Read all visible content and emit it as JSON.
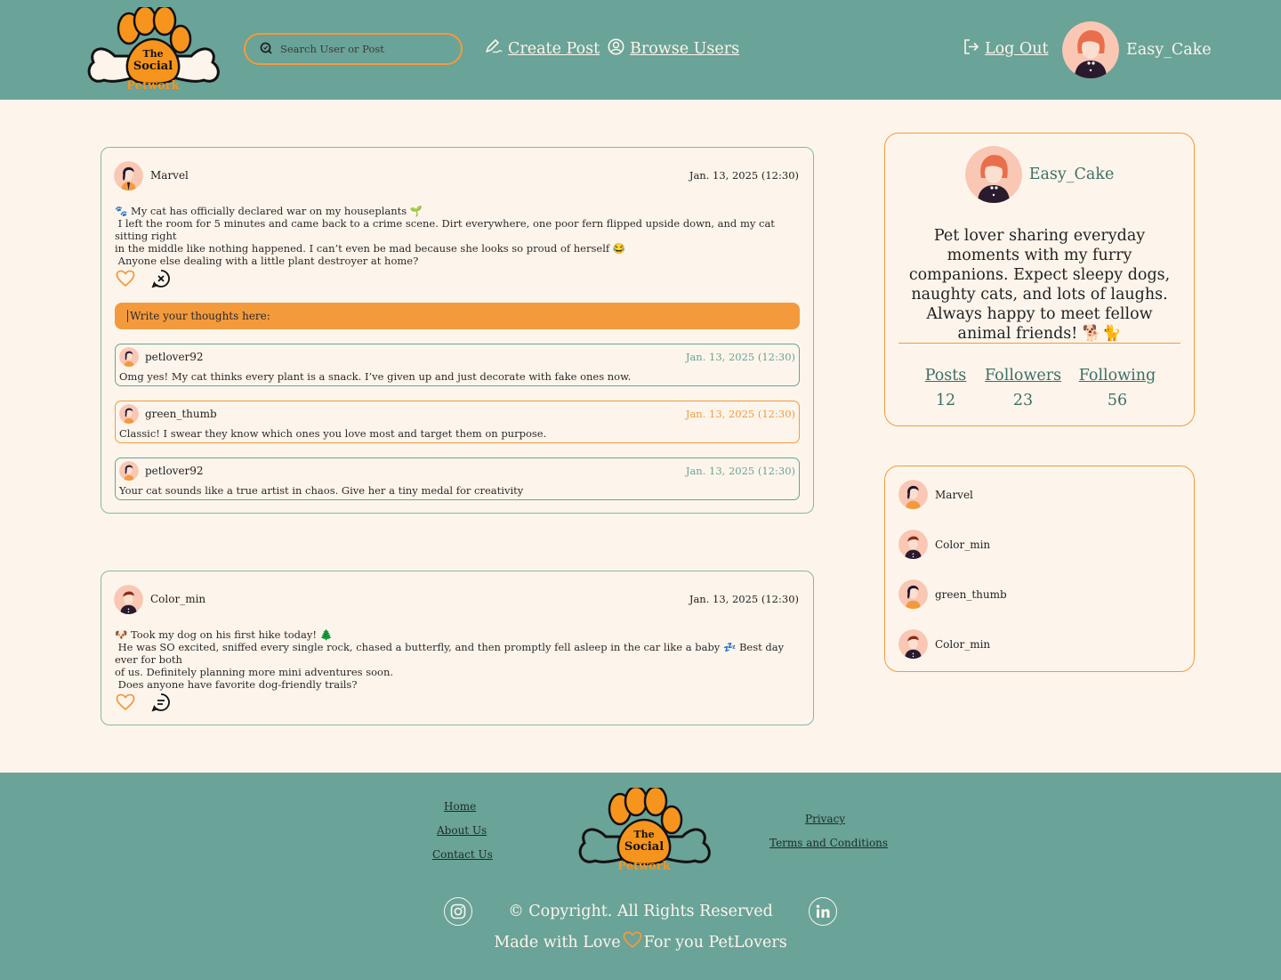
{
  "colors": {
    "teal": "#6aa397",
    "orange": "#f39a3d",
    "cream": "#fdf5ec"
  },
  "brand": {
    "line1": "The",
    "line2": "Social",
    "line3": "Petwork"
  },
  "header": {
    "search_placeholder": "Search User or Post",
    "create_post": "Create Post",
    "browse_users": "Browse Users",
    "log_out": "Log Out",
    "username": "Easy_Cake"
  },
  "posts": [
    {
      "author": "Marvel",
      "date": "Jan. 13, 2025 (12:30)",
      "lines": [
        "🐾 My cat has officially declared war on my houseplants 🌱",
        " I left the room for 5 minutes and came back to a crime scene. Dirt everywhere, one poor fern flipped upside down, and my cat sitting right",
        "in the middle like nothing happened. I can’t even be mad because she looks so proud of herself 😂",
        " Anyone else dealing with a little plant destroyer at home?"
      ],
      "comment_prompt": "Write your thoughts here:",
      "comments": [
        {
          "author": "petlover92",
          "date": "Jan. 13, 2025 (12:30)",
          "text": "Omg yes! My cat thinks every plant is a snack. I’ve given up and just decorate with fake ones now."
        },
        {
          "author": "green_thumb",
          "date": "Jan. 13, 2025 (12:30)",
          "text": "Classic! I swear they know which ones you love most and target them on purpose."
        },
        {
          "author": "petlover92",
          "date": "Jan. 13, 2025 (12:30)",
          "text": "Your cat sounds like a true artist in chaos. Give her a tiny medal for creativity"
        }
      ]
    },
    {
      "author": "Color_min",
      "date": "Jan. 13, 2025 (12:30)",
      "lines": [
        "🐶 Took my dog on his first hike today! 🌲",
        " He was SO excited, sniffed every single rock, chased a butterfly, and then promptly fell asleep in the car like a baby 💤 Best day ever for both",
        "of us. Definitely planning more mini adventures soon.",
        " Does anyone have favorite dog-friendly trails?"
      ]
    }
  ],
  "profile": {
    "username": "Easy_Cake",
    "bio": "Pet lover sharing everyday moments with my furry companions. Expect sleepy dogs, naughty cats, and lots of laughs. Always happy to meet fellow animal friends! 🐕🐈",
    "stats": [
      {
        "label": "Posts",
        "value": "12"
      },
      {
        "label": "Followers",
        "value": "23"
      },
      {
        "label": "Following",
        "value": "56"
      }
    ]
  },
  "friends": [
    "Marvel",
    "Color_min",
    "green_thumb",
    "Color_min"
  ],
  "footer": {
    "links_left": [
      "Home",
      "About Us",
      "Contact Us"
    ],
    "links_right": [
      "Privacy",
      "Terms and Conditions"
    ],
    "copyright": "© Copyright. All Rights Reserved",
    "made_with": "Made with Love",
    "for_you": "For you PetLovers"
  }
}
